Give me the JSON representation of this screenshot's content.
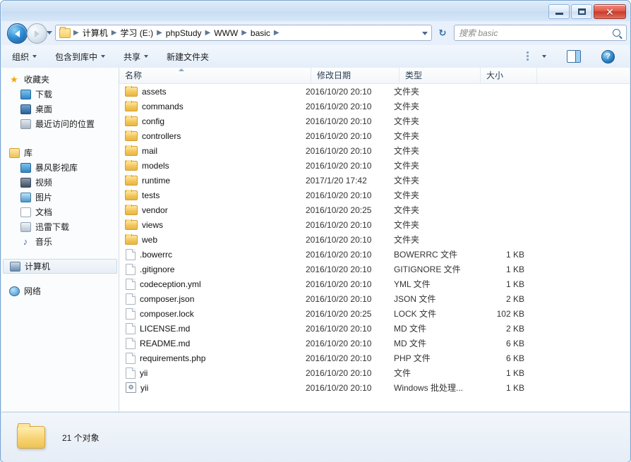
{
  "window": {
    "controls": {
      "minimize": "最小化",
      "maximize": "最大化",
      "close": "关闭",
      "close_glyph": "✕"
    }
  },
  "addressbar": {
    "back_label": "后退",
    "forward_label": "前进",
    "recent_label": "最近浏览的位置",
    "crumbs": [
      "计算机",
      "学习 (E:)",
      "phpStudy",
      "WWW",
      "basic"
    ],
    "separator": "▶",
    "refresh_glyph": "↻"
  },
  "search": {
    "placeholder": "搜索 basic"
  },
  "toolbar": {
    "organize": "组织",
    "include_in_library": "包含到库中",
    "share": "共享",
    "new_folder": "新建文件夹",
    "views_label": "更改您的视图",
    "preview_label": "显示预览窗格",
    "help_label": "获取帮助",
    "help_glyph": "?"
  },
  "sidebar": {
    "groups": [
      {
        "header": {
          "label": "收藏夹",
          "icon": "star-icon",
          "color": "#f0a90a"
        },
        "items": [
          {
            "label": "下载",
            "icon": "download-icon",
            "color": "#2f86c9"
          },
          {
            "label": "桌面",
            "icon": "desktop-icon",
            "color": "#3b6fa8"
          },
          {
            "label": "最近访问的位置",
            "icon": "recent-places-icon",
            "color": "#8d9aa8"
          }
        ]
      },
      {
        "header": {
          "label": "库",
          "icon": "library-icon",
          "color": "#e0b347"
        },
        "items": [
          {
            "label": "暴风影视库",
            "icon": "video-library-icon",
            "color": "#2f86c9"
          },
          {
            "label": "视频",
            "icon": "videos-icon",
            "color": "#44566b"
          },
          {
            "label": "图片",
            "icon": "pictures-icon",
            "color": "#4d96c9"
          },
          {
            "label": "文档",
            "icon": "documents-icon",
            "color": "#9aa7b4"
          },
          {
            "label": "迅雷下载",
            "icon": "thunder-download-icon",
            "color": "#8fa2b6"
          },
          {
            "label": "音乐",
            "icon": "music-icon",
            "color": "#3b6fa8"
          }
        ]
      },
      {
        "header": {
          "label": "计算机",
          "icon": "computer-icon",
          "color": "#5a7ea6",
          "selected": true
        },
        "items": []
      },
      {
        "header": {
          "label": "网络",
          "icon": "network-icon",
          "color": "#3f8bc4"
        },
        "items": []
      }
    ]
  },
  "filelist": {
    "columns": [
      {
        "key": "name",
        "label": "名称",
        "sorted": "asc"
      },
      {
        "key": "date",
        "label": "修改日期"
      },
      {
        "key": "type",
        "label": "类型"
      },
      {
        "key": "size",
        "label": "大小"
      }
    ],
    "rows": [
      {
        "icon": "folder-icon",
        "name": "assets",
        "date": "2016/10/20 20:10",
        "type": "文件夹",
        "size": ""
      },
      {
        "icon": "folder-icon",
        "name": "commands",
        "date": "2016/10/20 20:10",
        "type": "文件夹",
        "size": ""
      },
      {
        "icon": "folder-icon",
        "name": "config",
        "date": "2016/10/20 20:10",
        "type": "文件夹",
        "size": ""
      },
      {
        "icon": "folder-icon",
        "name": "controllers",
        "date": "2016/10/20 20:10",
        "type": "文件夹",
        "size": ""
      },
      {
        "icon": "folder-icon",
        "name": "mail",
        "date": "2016/10/20 20:10",
        "type": "文件夹",
        "size": ""
      },
      {
        "icon": "folder-icon",
        "name": "models",
        "date": "2016/10/20 20:10",
        "type": "文件夹",
        "size": ""
      },
      {
        "icon": "folder-icon",
        "name": "runtime",
        "date": "2017/1/20 17:42",
        "type": "文件夹",
        "size": ""
      },
      {
        "icon": "folder-icon",
        "name": "tests",
        "date": "2016/10/20 20:10",
        "type": "文件夹",
        "size": ""
      },
      {
        "icon": "folder-icon",
        "name": "vendor",
        "date": "2016/10/20 20:25",
        "type": "文件夹",
        "size": ""
      },
      {
        "icon": "folder-icon",
        "name": "views",
        "date": "2016/10/20 20:10",
        "type": "文件夹",
        "size": ""
      },
      {
        "icon": "folder-icon",
        "name": "web",
        "date": "2016/10/20 20:10",
        "type": "文件夹",
        "size": ""
      },
      {
        "icon": "document-icon",
        "name": ".bowerrc",
        "date": "2016/10/20 20:10",
        "type": "BOWERRC 文件",
        "size": "1 KB"
      },
      {
        "icon": "document-icon",
        "name": ".gitignore",
        "date": "2016/10/20 20:10",
        "type": "GITIGNORE 文件",
        "size": "1 KB"
      },
      {
        "icon": "document-icon",
        "name": "codeception.yml",
        "date": "2016/10/20 20:10",
        "type": "YML 文件",
        "size": "1 KB"
      },
      {
        "icon": "document-icon",
        "name": "composer.json",
        "date": "2016/10/20 20:10",
        "type": "JSON 文件",
        "size": "2 KB"
      },
      {
        "icon": "document-icon",
        "name": "composer.lock",
        "date": "2016/10/20 20:25",
        "type": "LOCK 文件",
        "size": "102 KB"
      },
      {
        "icon": "document-icon",
        "name": "LICENSE.md",
        "date": "2016/10/20 20:10",
        "type": "MD 文件",
        "size": "2 KB"
      },
      {
        "icon": "document-icon",
        "name": "README.md",
        "date": "2016/10/20 20:10",
        "type": "MD 文件",
        "size": "6 KB"
      },
      {
        "icon": "document-icon",
        "name": "requirements.php",
        "date": "2016/10/20 20:10",
        "type": "PHP 文件",
        "size": "6 KB"
      },
      {
        "icon": "document-icon",
        "name": "yii",
        "date": "2016/10/20 20:10",
        "type": "文件",
        "size": "1 KB"
      },
      {
        "icon": "batch-file-icon",
        "name": "yii",
        "date": "2016/10/20 20:10",
        "type": "Windows 批处理...",
        "size": "1 KB"
      }
    ]
  },
  "statusbar": {
    "text": "21 个对象"
  }
}
